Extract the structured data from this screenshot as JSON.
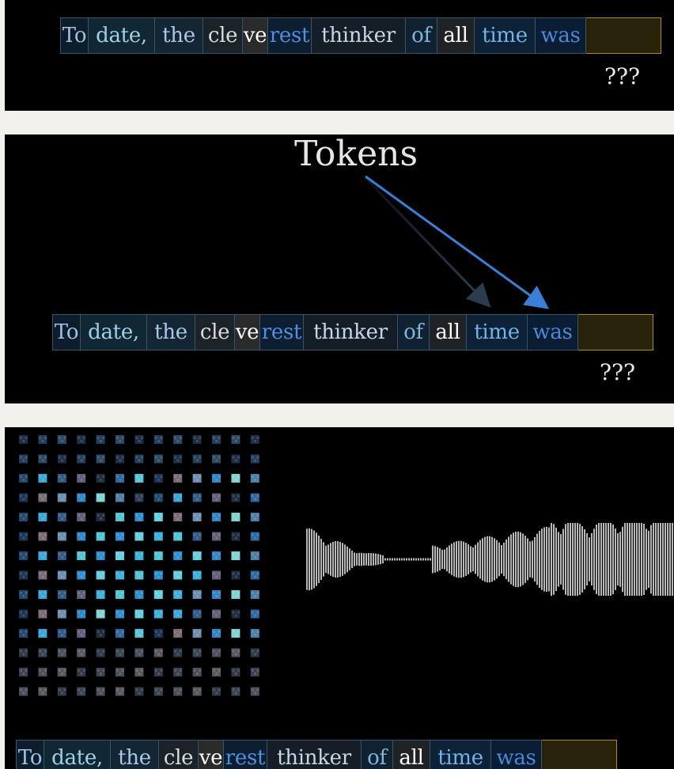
{
  "tokens": [
    {
      "text": "To",
      "color": "#9ec1e6",
      "bg": "#0d1d2b"
    },
    {
      "text": "date,",
      "color": "#9fd0e8",
      "bg": "#122734"
    },
    {
      "text": "the",
      "color": "#a8c8e8",
      "bg": "#142533"
    },
    {
      "text": "cle",
      "color": "#d8dde0",
      "bg": "#1b2329"
    },
    {
      "text": "ve",
      "color": "#ffffff",
      "bg": "#2b2a2a"
    },
    {
      "text": "rest",
      "color": "#4e8fe2",
      "bg": "#0e1e31"
    },
    {
      "text": "thinker",
      "color": "#c6d6e2",
      "bg": "#151e26"
    },
    {
      "text": "of",
      "color": "#7fb8da",
      "bg": "#102232"
    },
    {
      "text": "all",
      "color": "#ffffff",
      "bg": "#202325"
    },
    {
      "text": "time",
      "color": "#72b4e8",
      "bg": "#0d2137"
    },
    {
      "text": "was",
      "color": "#4a88d8",
      "bg": "#0b1d33"
    },
    {
      "text": "",
      "color": "#ffffff",
      "bg": "#272208"
    }
  ],
  "panel_1": {
    "unknown_label": "???"
  },
  "panel_2": {
    "title": "Tokens",
    "unknown_label": "???"
  },
  "panel_3": {}
}
